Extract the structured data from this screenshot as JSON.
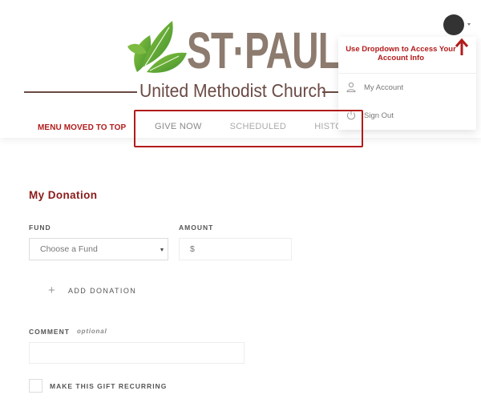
{
  "header": {
    "logo": {
      "title": "ST·PAUL",
      "subtitle": "United Methodist Church"
    },
    "menu_note": "MENU MOVED TO TOP",
    "nav": [
      {
        "label": "GIVE NOW",
        "active": true
      },
      {
        "label": "SCHEDULED",
        "active": false
      },
      {
        "label": "HISTORY",
        "active": false
      }
    ],
    "avatar": {
      "icon": "user-avatar"
    },
    "dropdown": {
      "note": "Use Dropdown to Access Your Account Info",
      "items": [
        {
          "label": "My Account",
          "icon": "user-icon"
        },
        {
          "label": "Sign Out",
          "icon": "power-icon"
        }
      ]
    }
  },
  "colors": {
    "accent_red": "#b31b1b",
    "title_red": "#8b1a1a",
    "logo_brown": "#8c7b6e",
    "logo_green": "#6cb33f"
  },
  "form": {
    "title": "My Donation",
    "fund": {
      "label": "FUND",
      "selected": "Choose a Fund"
    },
    "amount": {
      "label": "AMOUNT",
      "prefix": "$",
      "value": ""
    },
    "add_donation": "ADD DONATION",
    "comment": {
      "label": "COMMENT",
      "optional": "optional",
      "value": ""
    },
    "recurring": {
      "label": "MAKE THIS GIFT RECURRING",
      "checked": false
    }
  }
}
